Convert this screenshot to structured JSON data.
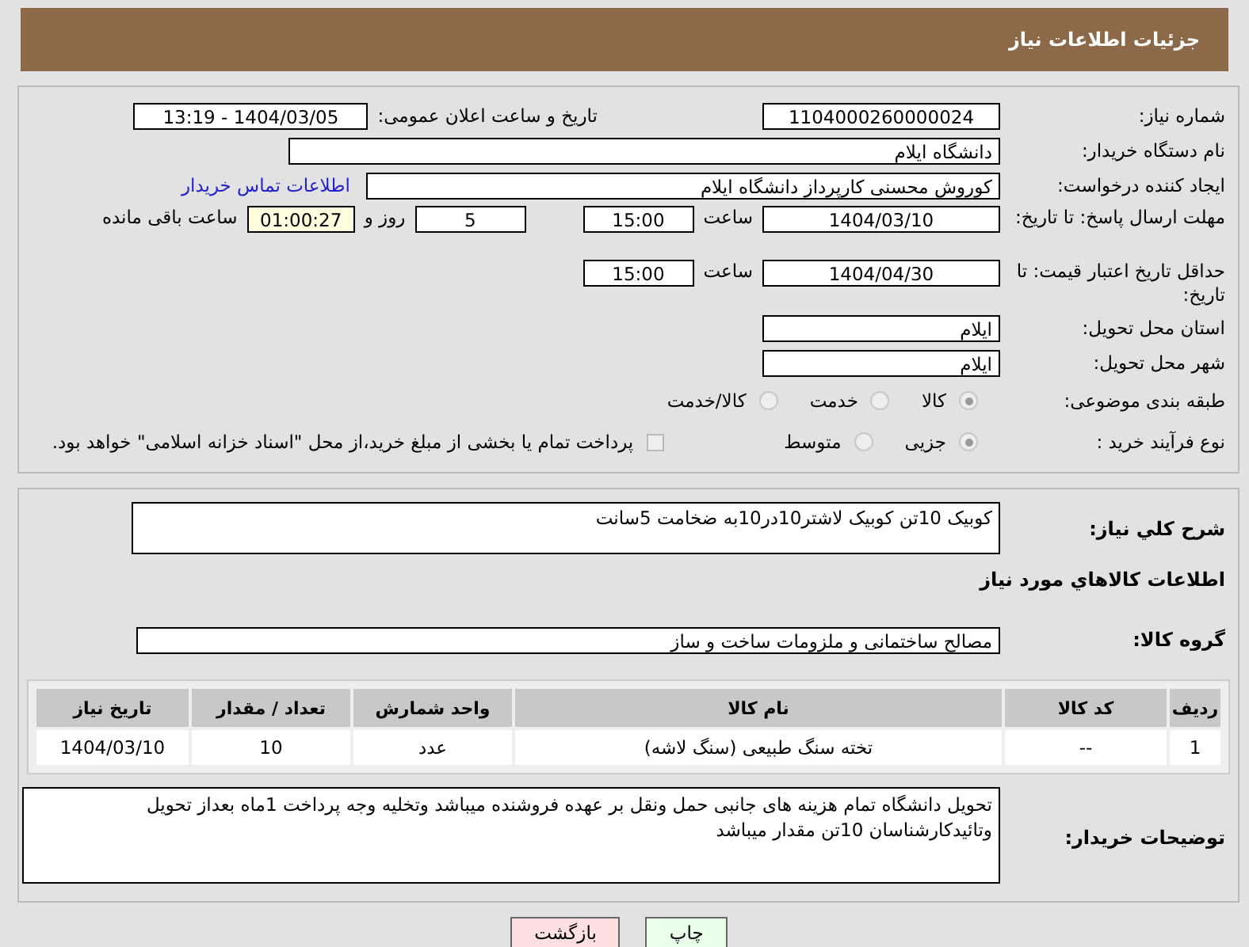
{
  "header": {
    "title": "جزئیات اطلاعات نیاز"
  },
  "need_number": {
    "label": "شماره نیاز:",
    "value": "1104000260000024"
  },
  "announce": {
    "label": "تاریخ و ساعت اعلان عمومی:",
    "value": "1404/03/05 - 13:19"
  },
  "buyer_org": {
    "label": "نام دستگاه خریدار:",
    "value": "دانشگاه ایلام"
  },
  "requester": {
    "label": "ایجاد کننده درخواست:",
    "value": "کوروش محسنی کارپرداز دانشگاه ایلام",
    "link": "اطلاعات تماس خریدار"
  },
  "deadline": {
    "label": "مهلت ارسال پاسخ: تا تاریخ:",
    "date": "1404/03/10",
    "time_label": "ساعت",
    "time": "15:00",
    "days": "5",
    "days_label": "روز و",
    "remaining": "01:00:27",
    "remaining_label": "ساعت باقی مانده"
  },
  "validity": {
    "label": "حداقل تاریخ اعتبار قیمت: تا تاریخ:",
    "date": "1404/04/30",
    "time_label": "ساعت",
    "time": "15:00"
  },
  "province": {
    "label": "استان محل تحویل:",
    "value": "ایلام"
  },
  "city": {
    "label": "شهر محل تحویل:",
    "value": "ایلام"
  },
  "category": {
    "label": "طبقه بندی موضوعی:",
    "options": [
      {
        "label": "کالا",
        "selected": true
      },
      {
        "label": "خدمت",
        "selected": false
      },
      {
        "label": "کالا/خدمت",
        "selected": false
      }
    ]
  },
  "process": {
    "label": "نوع فرآیند خرید :",
    "options": [
      {
        "label": "جزیی",
        "selected": true
      },
      {
        "label": "متوسط",
        "selected": false
      }
    ],
    "payment": {
      "checked": false,
      "label": "پرداخت تمام یا بخشی از مبلغ خرید،از محل \"اسناد خزانه اسلامی\" خواهد بود."
    }
  },
  "description": {
    "label": "شرح کلي نياز:",
    "value": "کوبیک 10تن کوبیک لاشتر10در10به ضخامت 5سانت"
  },
  "items_heading": "اطلاعات کالاهاي مورد نياز",
  "goods_group": {
    "label": "گروه کالا:",
    "value": "مصالح ساختمانی و ملزومات ساخت و ساز"
  },
  "table": {
    "columns": [
      "ردیف",
      "کد کالا",
      "نام کالا",
      "واحد شمارش",
      "تعداد / مقدار",
      "تاریخ نیاز"
    ],
    "rows": [
      [
        "1",
        "--",
        "تخته سنگ طبیعی (سنگ لاشه)",
        "عدد",
        "10",
        "1404/03/10"
      ]
    ]
  },
  "buyer_notes": {
    "label": "توضیحات خریدار:",
    "value": "تحویل دانشگاه تمام هزینه های جانبی حمل ونقل بر عهده فروشنده میباشد وتخلیه وجه پرداخت 1ماه بعداز تحویل وتائیدکارشناسان 10تن مقدار میباشد"
  },
  "buttons": [
    {
      "label": "چاپ",
      "kind": "print"
    },
    {
      "label": "بازگشت",
      "kind": "back"
    }
  ]
}
